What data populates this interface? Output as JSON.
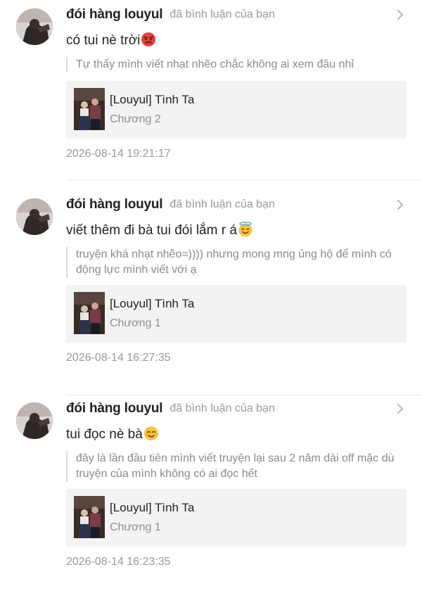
{
  "notifications": [
    {
      "username": "đói hàng louyul",
      "action": "đã bình luận của bạn",
      "comment": "có tui nè trời",
      "emoji": "angry-face-emoji",
      "quote": "Tự thấy mình viết nhạt nhẽo chắc không ai xem đâu nhỉ",
      "story_title": "[Louyul] Tình Ta",
      "chapter": "Chương 2",
      "timestamp": "2026-08-14 19:21:17"
    },
    {
      "username": "đói hàng louyul",
      "action": "đã bình luận của bạn",
      "comment": "viết thêm đi bà tui đói lắm r á",
      "emoji": "halo-smiling-face-emoji",
      "quote": "truyện khá nhạt nhẽo=)))) nhưng mong mng ủng hộ để mình có động lực mình viết với ạ",
      "story_title": "[Louyul] Tình Ta",
      "chapter": "Chương 1",
      "timestamp": "2026-08-14 16:27:35"
    },
    {
      "username": "đói hàng louyul",
      "action": "đã bình luận của bạn",
      "comment": "tui đọc nè bà",
      "emoji": "smiling-face-emoji",
      "quote": "đây là lần đầu tiên mình viết truyện lại sau 2 năm dài off mặc dù truyện của mình không có ai đọc hết",
      "story_title": "[Louyul] Tình Ta",
      "chapter": "Chương 1",
      "timestamp": "2026-08-14 16:23:35"
    }
  ],
  "colors": {
    "background": "#ffffff",
    "card_background": "#f3f3f3",
    "muted_text": "#999999",
    "quote_bar": "#dcdcdc",
    "emoji_yellow": "#f7c43a",
    "emoji_red": "#e0433a"
  }
}
